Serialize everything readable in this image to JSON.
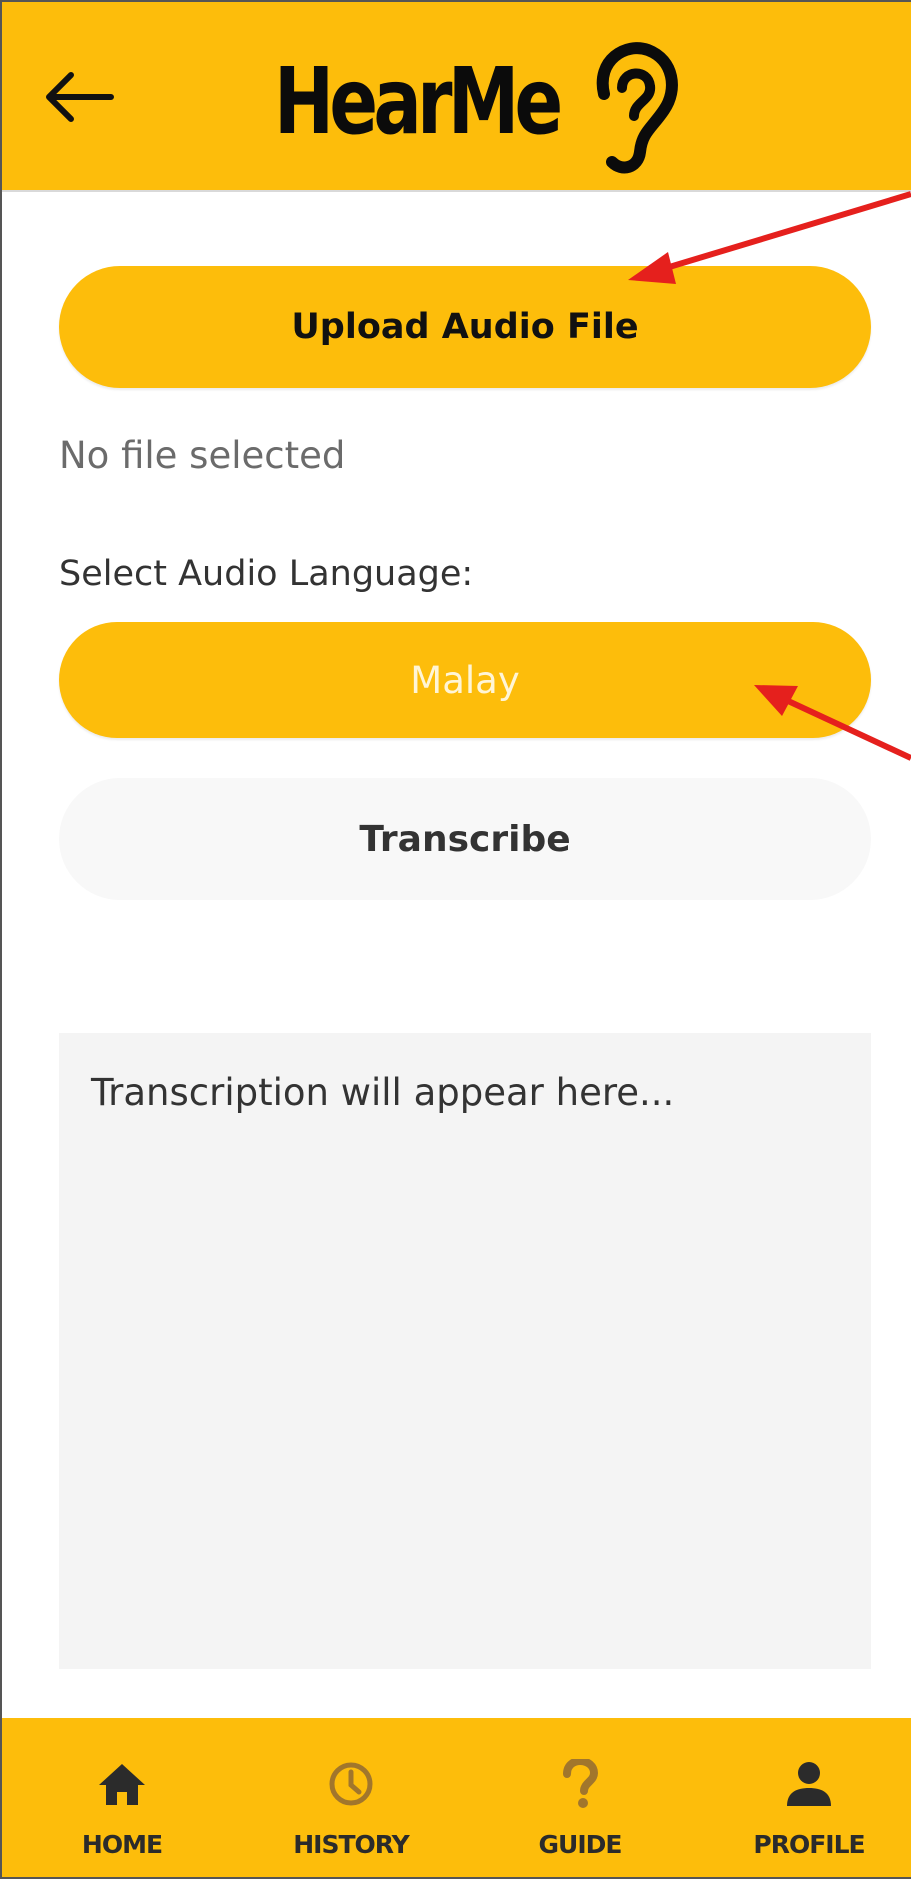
{
  "header": {
    "logo_text": "HearMe",
    "background": "#FDBD0B",
    "back_icon": "arrow-left-icon",
    "logo_icon": "ear-icon"
  },
  "upload": {
    "label": "Upload Audio File",
    "status": "No file selected"
  },
  "language": {
    "label": "Select Audio Language:",
    "selected": "Malay"
  },
  "transcribe": {
    "label": "Transcribe"
  },
  "transcript": {
    "placeholder": "Transcription will appear here..."
  },
  "nav": {
    "items": [
      {
        "label": "HOME",
        "icon": "home-icon",
        "active": true
      },
      {
        "label": "HISTORY",
        "icon": "clock-icon",
        "active": false
      },
      {
        "label": "GUIDE",
        "icon": "question-icon",
        "active": false
      },
      {
        "label": "PROFILE",
        "icon": "user-icon",
        "active": false
      }
    ]
  },
  "colors": {
    "accent": "#FDBD0B",
    "annotation": "#E5201D",
    "inactive_icon": "#a1762c"
  }
}
